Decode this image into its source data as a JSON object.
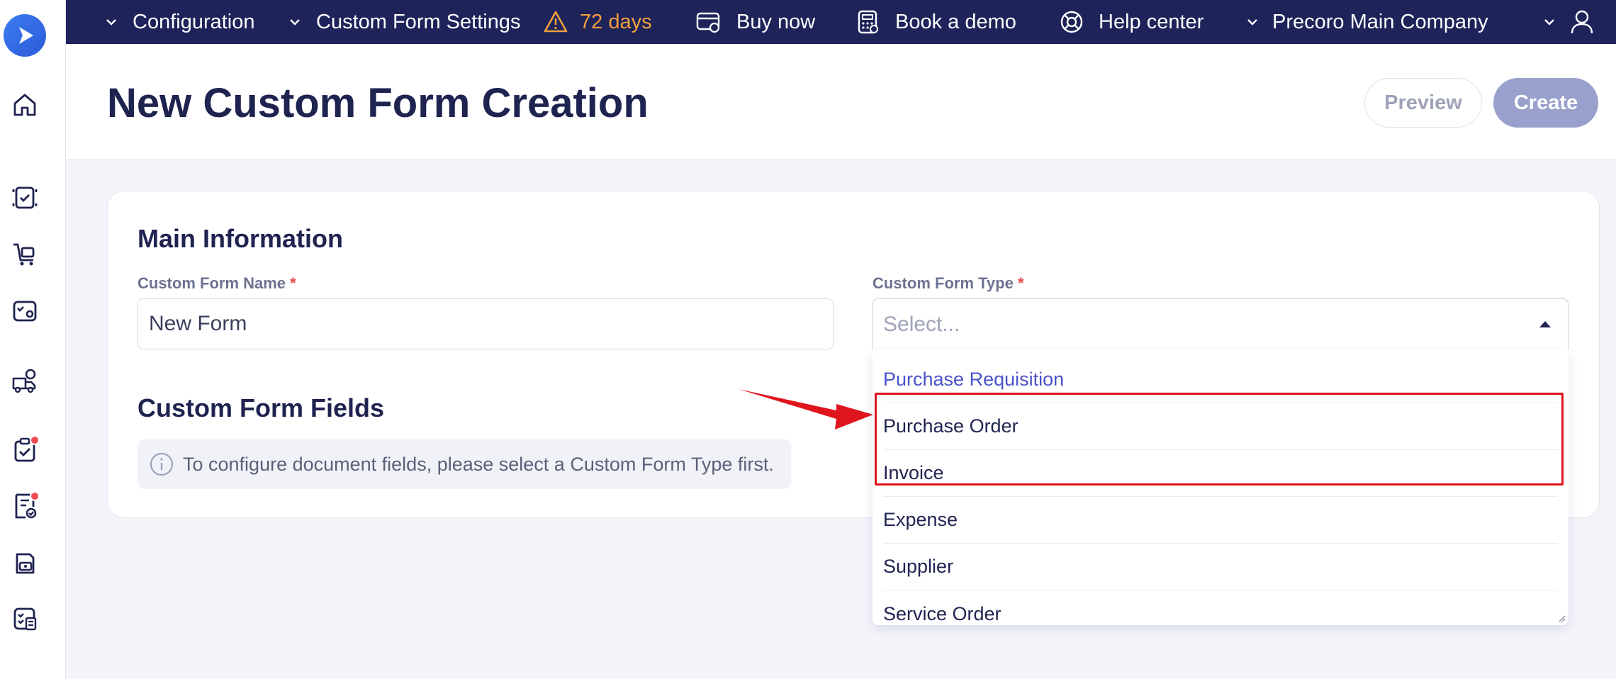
{
  "topbar": {
    "configuration": "Configuration",
    "custom_form_settings": "Custom Form Settings",
    "trial_days": "72 days",
    "buy_now": "Buy now",
    "book_demo": "Book a demo",
    "help_center": "Help center",
    "company": "Precoro Main Company"
  },
  "header": {
    "title": "New Custom Form Creation",
    "preview_label": "Preview",
    "create_label": "Create"
  },
  "main_info": {
    "section_title": "Main Information",
    "name_label": "Custom Form Name",
    "name_value": "New Form",
    "type_label": "Custom Form Type",
    "type_placeholder": "Select...",
    "required_mark": "*"
  },
  "fields": {
    "section_title": "Custom Form Fields",
    "info_text": "To configure document fields, please select a Custom Form Type first."
  },
  "dropdown": {
    "options": [
      "Purchase Requisition",
      "Purchase Order",
      "Invoice",
      "Expense",
      "Supplier",
      "Service Order"
    ],
    "highlighted_option": "Purchase Requisition"
  },
  "colors": {
    "topbar": "#1e235a",
    "accent": "#4a52c9",
    "trial_warning": "#f2a03d",
    "annotation": "#e0141c"
  },
  "icons": {
    "sidebar": [
      "logo-icon",
      "home-icon",
      "documents-icon",
      "cart-icon",
      "approval-icon",
      "supplier-icon",
      "clipboard-check-icon",
      "invoice-icon",
      "payment-icon",
      "checklist-icon"
    ],
    "topbar": [
      "chevron-down-icon",
      "warning-icon",
      "card-icon",
      "calculator-icon",
      "lifebuoy-icon",
      "user-icon"
    ]
  }
}
